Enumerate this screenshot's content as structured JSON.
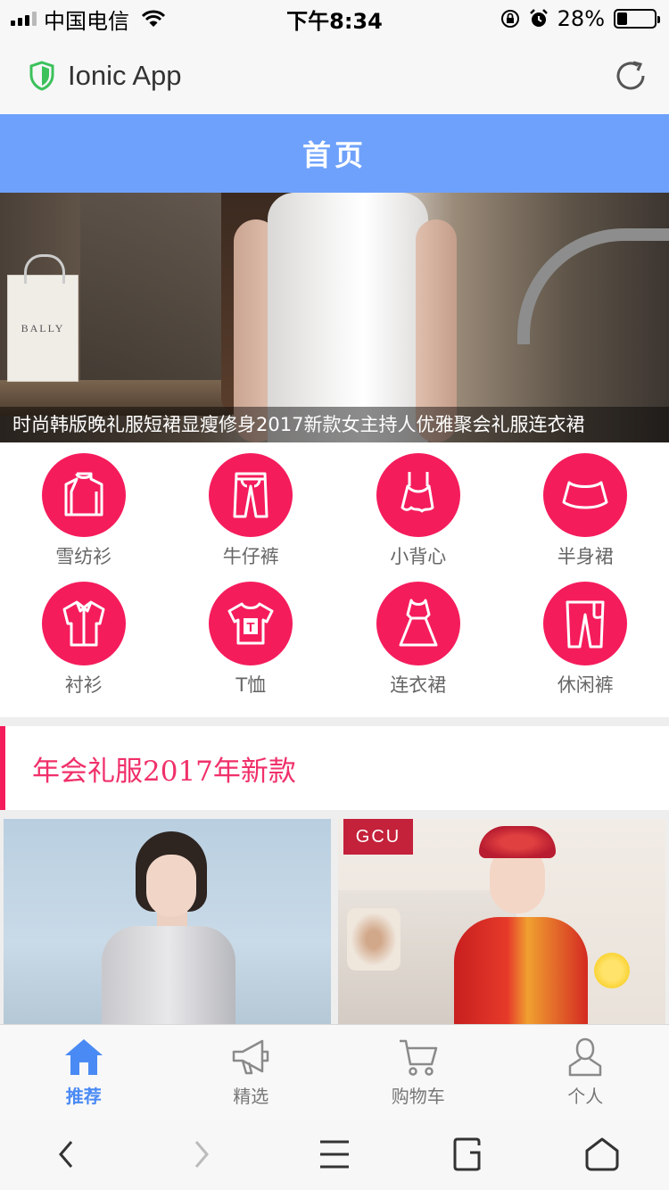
{
  "status_bar": {
    "carrier": "中国电信",
    "time": "下午8:34",
    "battery_percent": "28%",
    "battery_level": 0.28,
    "icons": [
      "signal-icon",
      "wifi-icon",
      "orientation-lock-icon",
      "alarm-icon",
      "battery-icon"
    ]
  },
  "app_header": {
    "title": "Ionic App",
    "icons": [
      "shield-icon",
      "refresh-icon"
    ],
    "accent": "#3cc15b"
  },
  "nav_bar": {
    "title": "首页",
    "color": "#6ea1fb"
  },
  "banner": {
    "caption": "时尚韩版晚礼服短裙显瘦修身2017新款女主持人优雅聚会礼服连衣裙",
    "bag_text": "BALLY"
  },
  "categories": [
    {
      "label": "雪纺衫",
      "icon": "chiffon-shirt-icon"
    },
    {
      "label": "牛仔裤",
      "icon": "jeans-icon"
    },
    {
      "label": "小背心",
      "icon": "camisole-icon"
    },
    {
      "label": "半身裙",
      "icon": "skirt-icon"
    },
    {
      "label": "衬衫",
      "icon": "shirt-icon"
    },
    {
      "label": "T恤",
      "icon": "tshirt-icon"
    },
    {
      "label": "连衣裙",
      "icon": "dress-icon"
    },
    {
      "label": "休闲裤",
      "icon": "casual-pants-icon"
    }
  ],
  "category_color": "#f51c5c",
  "section": {
    "title": "年会礼服2017年新款"
  },
  "products": [
    {
      "image": "gown-model-photo"
    },
    {
      "image": "qipao-bride-photo",
      "badge": "GCU"
    }
  ],
  "tab_bar": {
    "items": [
      {
        "label": "推荐",
        "icon": "home-icon",
        "active": true
      },
      {
        "label": "精选",
        "icon": "megaphone-icon",
        "active": false
      },
      {
        "label": "购物车",
        "icon": "cart-icon",
        "active": false
      },
      {
        "label": "个人",
        "icon": "person-icon",
        "active": false
      }
    ],
    "active_color": "#4a8af4"
  },
  "browser_bar": {
    "icons": [
      "back-icon",
      "forward-icon",
      "menu-icon",
      "tabs-icon",
      "home-outline-icon"
    ]
  }
}
